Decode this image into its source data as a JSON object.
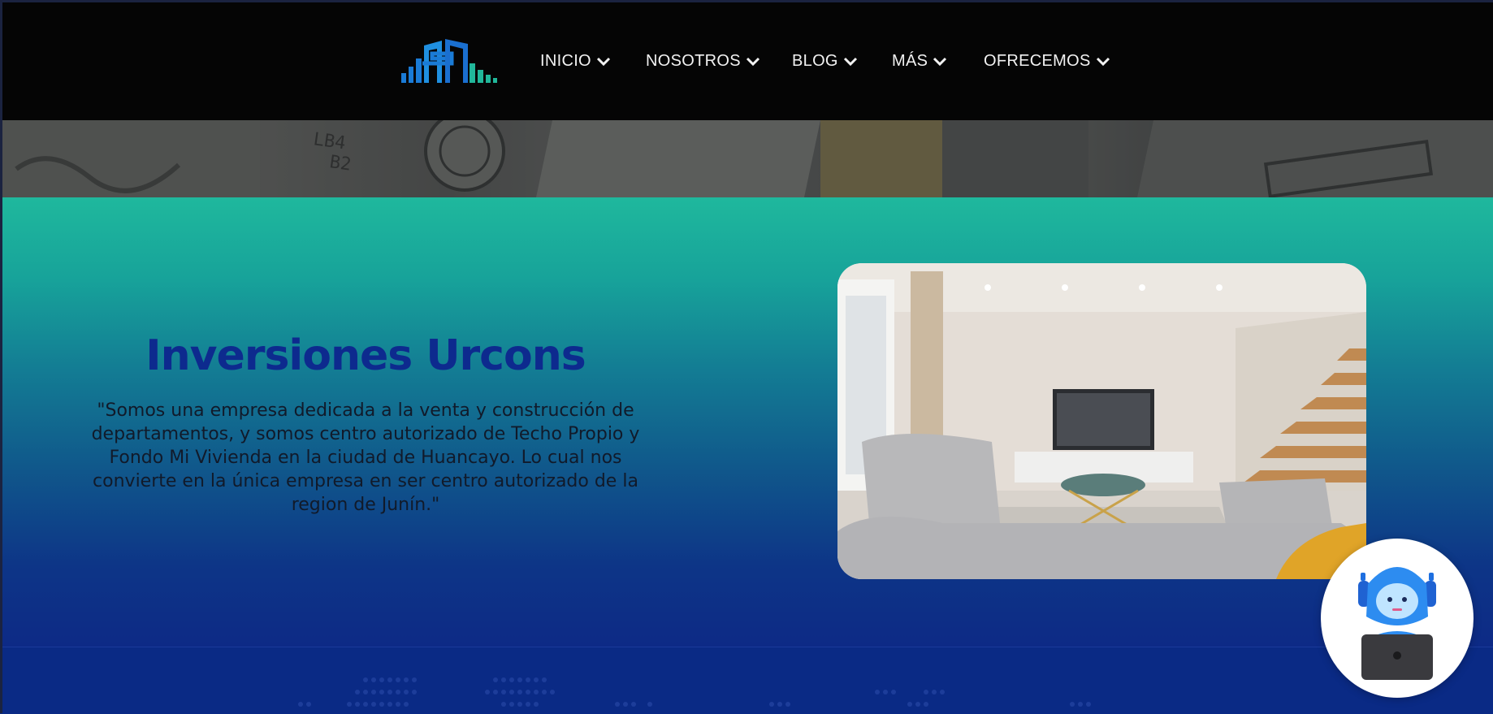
{
  "nav": {
    "items": [
      {
        "label": "INICIO"
      },
      {
        "label": "NOSOTROS"
      },
      {
        "label": "BLOG"
      },
      {
        "label": "MÁS"
      },
      {
        "label": "OFRECEMOS"
      }
    ]
  },
  "hero": {
    "title": "Inversiones Urcons",
    "text": "\"Somos una empresa dedicada a la venta y construcción de departamentos, y somos centro autorizado de Techo Propio y Fondo Mi Vivienda en la ciudad de Huancayo. Lo cual nos convierte en la única empresa en ser centro autorizado de la region de Junín.\""
  },
  "colors": {
    "header_bg": "#050505",
    "hero_top": "#1fb89d",
    "hero_bottom": "#0d2a86",
    "title": "#0d2a8e",
    "logo_blue": "#1a7bd6",
    "logo_green": "#21b79a"
  },
  "icons": {
    "logo": "building-logo-icon",
    "chevron": "chevron-down-icon",
    "bot": "robot-assistant-icon"
  }
}
